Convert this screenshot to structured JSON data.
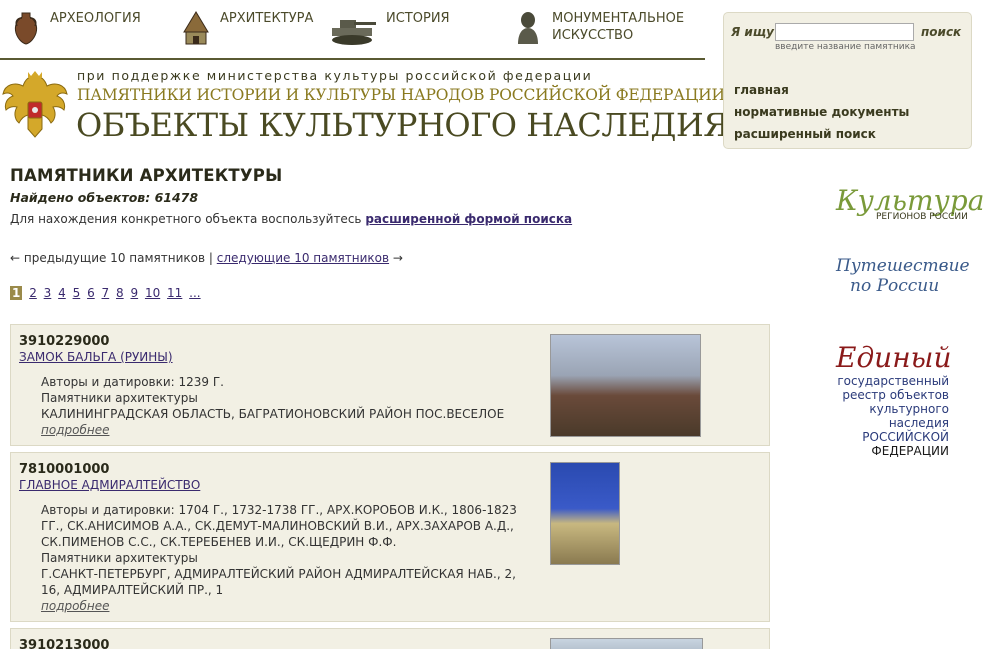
{
  "nav": {
    "categories": [
      {
        "label": "АРХЕОЛОГИЯ",
        "icon": "amphora-icon"
      },
      {
        "label": "АРХИТЕКТУРА",
        "icon": "tent-building-icon"
      },
      {
        "label": "ИСТОРИЯ",
        "icon": "tank-icon"
      },
      {
        "label": "МОНУМЕНТАЛЬНОЕ ИСКУССТВО",
        "icon": "bust-statue-icon"
      }
    ]
  },
  "header": {
    "support": "при поддержке министерства культуры российской федерации",
    "monuments": "ПАМЯТНИКИ ИСТОРИИ И КУЛЬТУРЫ НАРОДОВ РОССИЙСКОЙ ФЕДЕРАЦИИ",
    "objects": "ОБЪЕКТЫ КУЛЬТУРНОГО НАСЛЕДИЯ"
  },
  "search": {
    "label": "Я ищу",
    "value": "",
    "button": "поиск",
    "hint": "введите название памятника"
  },
  "side_links": [
    "главная",
    "нормативные документы",
    "расширенный поиск"
  ],
  "banners": {
    "kultura_big": "Культура",
    "kultura_small": "РЕГИОНОВ РОССИИ",
    "travel_line1": "Путешествие",
    "travel_line2": "по России",
    "registry_big": "Единый",
    "registry_lines": [
      "государственный",
      "реестр объектов",
      "культурного наследия",
      "РОССИЙСКОЙ",
      "ФЕДЕРАЦИИ"
    ]
  },
  "main": {
    "title": "ПАМЯТНИКИ АРХИТЕКТУРЫ",
    "found_label": "Найдено объектов:",
    "found_count": "61478",
    "hint_text": "Для нахождения конкретного объекта воспользуйтесь",
    "hint_link": "расширенной формой поиска",
    "prev": "← предыдущие 10 памятников",
    "separator": "|",
    "next": "следующие 10 памятников",
    "next_arrow": "→",
    "pages": [
      "1",
      "2",
      "3",
      "4",
      "5",
      "6",
      "7",
      "8",
      "9",
      "10",
      "11",
      "..."
    ],
    "current_page": "1"
  },
  "items": [
    {
      "code": "3910229000",
      "name": "ЗАМОК БАЛЬГА (РУИНЫ)",
      "authors": "Авторы и датировки: 1239 Г.",
      "category": "Памятники архитектуры",
      "address": "КАЛИНИНГРАДСКАЯ ОБЛАСТЬ, БАГРАТИОНОВСКИЙ РАЙОН ПОС.ВЕСЕЛОЕ",
      "more": "подробнее"
    },
    {
      "code": "7810001000",
      "name": "ГЛАВНОЕ АДМИРАЛТЕЙСТВО",
      "authors": "Авторы и датировки: 1704 Г., 1732-1738 ГГ., АРХ.КОРОБОВ И.К., 1806-1823 ГГ., СК.АНИСИМОВ А.А., СК.ДЕМУТ-МАЛИНОВСКИЙ В.И., АРХ.ЗАХАРОВ А.Д., СК.ПИМЕНОВ С.С., СК.ТЕРЕБЕНЕВ И.И., СК.ЩЕДРИН Ф.Ф.",
      "category": "Памятники архитектуры",
      "address": "Г.САНКТ-ПЕТЕРБУРГ, АДМИРАЛТЕЙСКИЙ РАЙОН АДМИРАЛТЕЙСКАЯ НАБ., 2, 16, АДМИРАЛТЕЙСКИЙ ПР., 1",
      "more": "подробнее"
    },
    {
      "code": "3910213000"
    }
  ]
}
